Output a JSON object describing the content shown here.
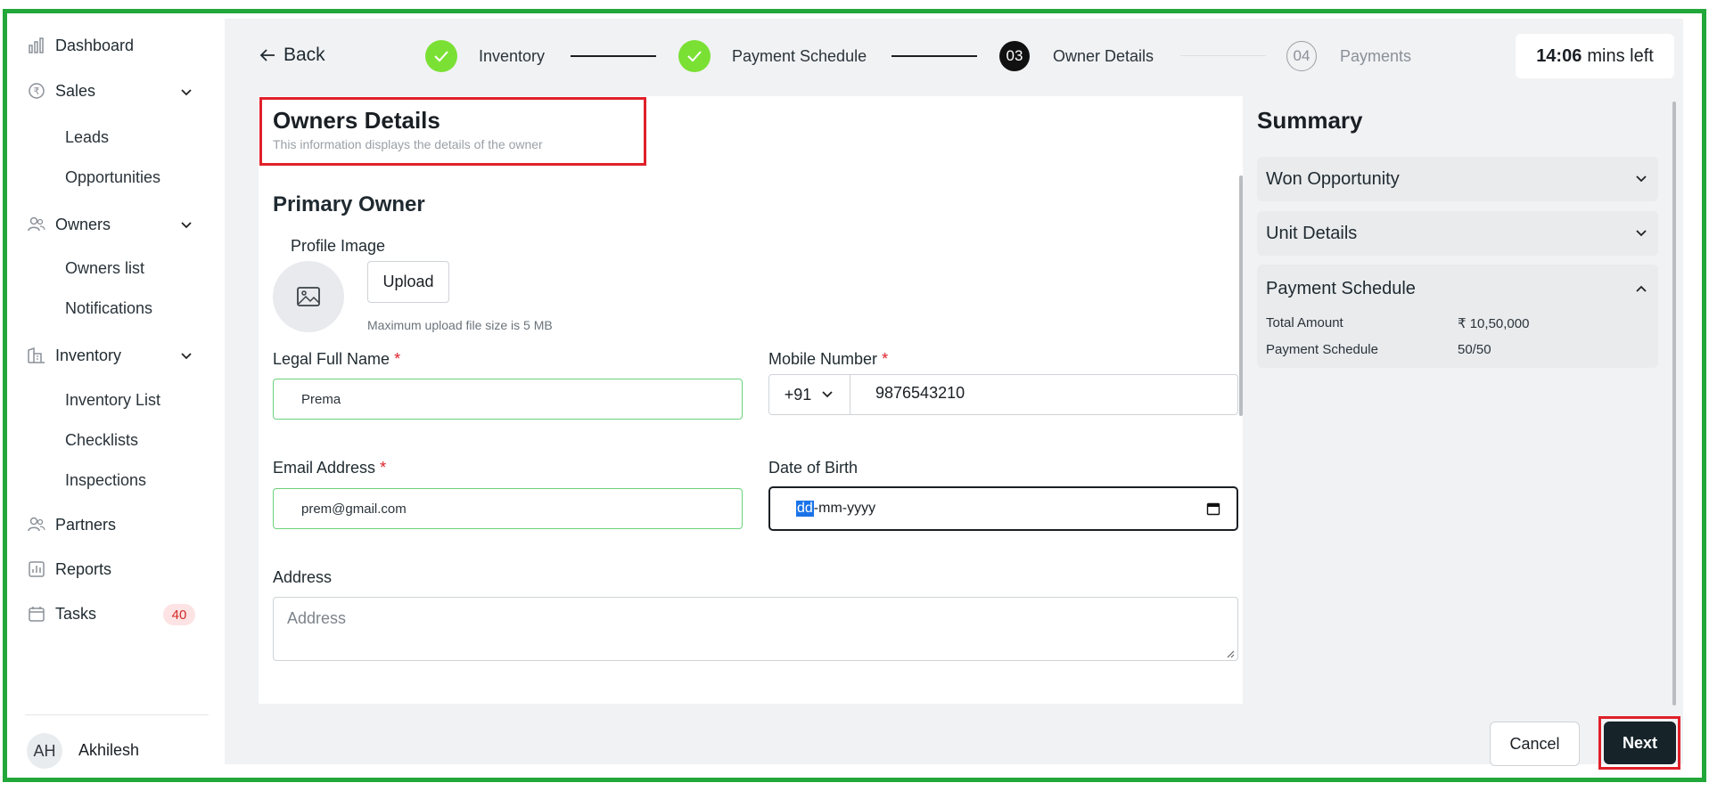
{
  "sidebar": {
    "dashboard": "Dashboard",
    "sales": "Sales",
    "leads": "Leads",
    "opportunities": "Opportunities",
    "owners": "Owners",
    "owners_list": "Owners list",
    "notifications": "Notifications",
    "inventory": "Inventory",
    "inventory_list": "Inventory List",
    "checklists": "Checklists",
    "inspections": "Inspections",
    "partners": "Partners",
    "reports": "Reports",
    "tasks": "Tasks",
    "tasks_count": "40",
    "user_initials": "AH",
    "user_name": "Akhilesh"
  },
  "header": {
    "back_label": "Back",
    "steps": [
      {
        "label": "Inventory",
        "status": "done"
      },
      {
        "label": "Payment Schedule",
        "status": "done"
      },
      {
        "number": "03",
        "label": "Owner Details",
        "status": "current"
      },
      {
        "number": "04",
        "label": "Payments",
        "status": "upcoming"
      }
    ],
    "timer_value": "14:06",
    "timer_suffix": "mins left"
  },
  "form": {
    "title": "Owners Details",
    "subtitle": "This information displays the details of the owner",
    "primary_owner": "Primary Owner",
    "profile_image_label": "Profile Image",
    "upload_label": "Upload",
    "upload_hint": "Maximum upload file size is 5 MB",
    "legal_name_label": "Legal Full Name",
    "legal_name_value": "Prema",
    "mobile_label": "Mobile Number",
    "country_code": "+91",
    "mobile_value": "9876543210",
    "email_label": "Email Address",
    "email_value": "prem@gmail.com",
    "dob_label": "Date of Birth",
    "dob_selected": "dd",
    "dob_rest": "-mm-yyyy",
    "address_label": "Address",
    "address_placeholder": "Address",
    "required_mark": "*"
  },
  "summary": {
    "title": "Summary",
    "sections": [
      "Won Opportunity",
      "Unit Details",
      "Payment Schedule"
    ],
    "total_amount_label": "Total Amount",
    "total_amount_value": "₹ 10,50,000",
    "payment_schedule_label": "Payment Schedule",
    "payment_schedule_value": "50/50"
  },
  "footer": {
    "cancel_label": "Cancel",
    "next_label": "Next"
  },
  "colors": {
    "frame": "#22a83a",
    "highlight": "#e0202a",
    "step_done": "#7be034",
    "primary_button": "#16242a"
  }
}
